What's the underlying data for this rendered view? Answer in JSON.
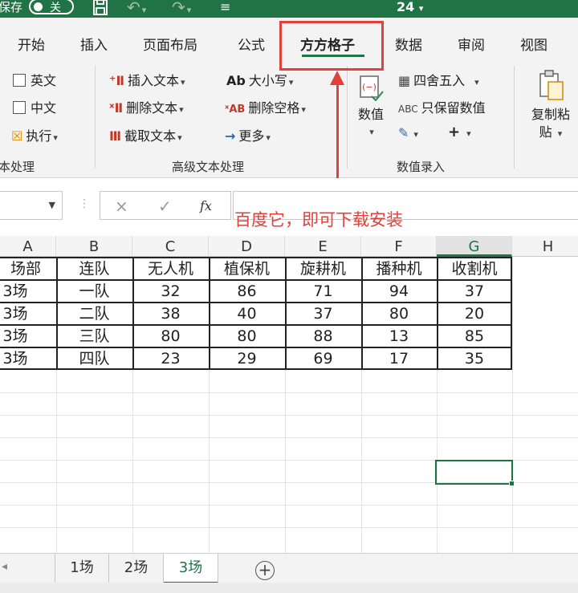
{
  "titlebar": {
    "save_label": "保存",
    "autosave_state": "关",
    "zoom_title": "24",
    "icons": [
      "save-icon",
      "undo-icon",
      "redo-icon",
      "customize-icon"
    ]
  },
  "tabs": [
    {
      "label": "开始"
    },
    {
      "label": "插入"
    },
    {
      "label": "页面布局"
    },
    {
      "label": "公式"
    },
    {
      "label": "方方格子",
      "active": true
    },
    {
      "label": "数据"
    },
    {
      "label": "审阅"
    },
    {
      "label": "视图"
    }
  ],
  "ribbon": {
    "text_group": {
      "english": "英文",
      "chinese": "中文",
      "execute": "执行",
      "label": "本处理"
    },
    "advanced_group": {
      "insert_text": "插入文本",
      "delete_text": "删除文本",
      "cut_text": "截取文本",
      "case": "大小写",
      "delete_space": "删除空格",
      "more": "更多",
      "label": "高级文本处理"
    },
    "value_group": {
      "value": "数值",
      "round": "四舍五入",
      "keep_value": "只保留数值",
      "label": "数值录入"
    },
    "copy_paste": {
      "line1": "复制粘",
      "line2": "贴"
    }
  },
  "formula_bar": {
    "fx": "fx",
    "cancel": "×",
    "confirm": "✓"
  },
  "annotation": "百度它，即可下载安装",
  "accent": "#217346",
  "annotation_color": "#e2403a",
  "sheet": {
    "columns": [
      "A",
      "B",
      "C",
      "D",
      "E",
      "F",
      "G",
      "H"
    ],
    "selected_column": "G",
    "rows": [
      [
        "场部",
        "连队",
        "无人机",
        "植保机",
        "旋耕机",
        "播种机",
        "收割机"
      ],
      [
        "3场",
        "一队",
        "32",
        "86",
        "71",
        "94",
        "37"
      ],
      [
        "3场",
        "二队",
        "38",
        "40",
        "37",
        "80",
        "20"
      ],
      [
        "3场",
        "三队",
        "80",
        "80",
        "88",
        "13",
        "85"
      ],
      [
        "3场",
        "四队",
        "23",
        "29",
        "69",
        "17",
        "35"
      ]
    ]
  },
  "sheet_tabs": [
    {
      "label": "1场"
    },
    {
      "label": "2场"
    },
    {
      "label": "3场",
      "active": true
    }
  ],
  "add_sheet": "+"
}
